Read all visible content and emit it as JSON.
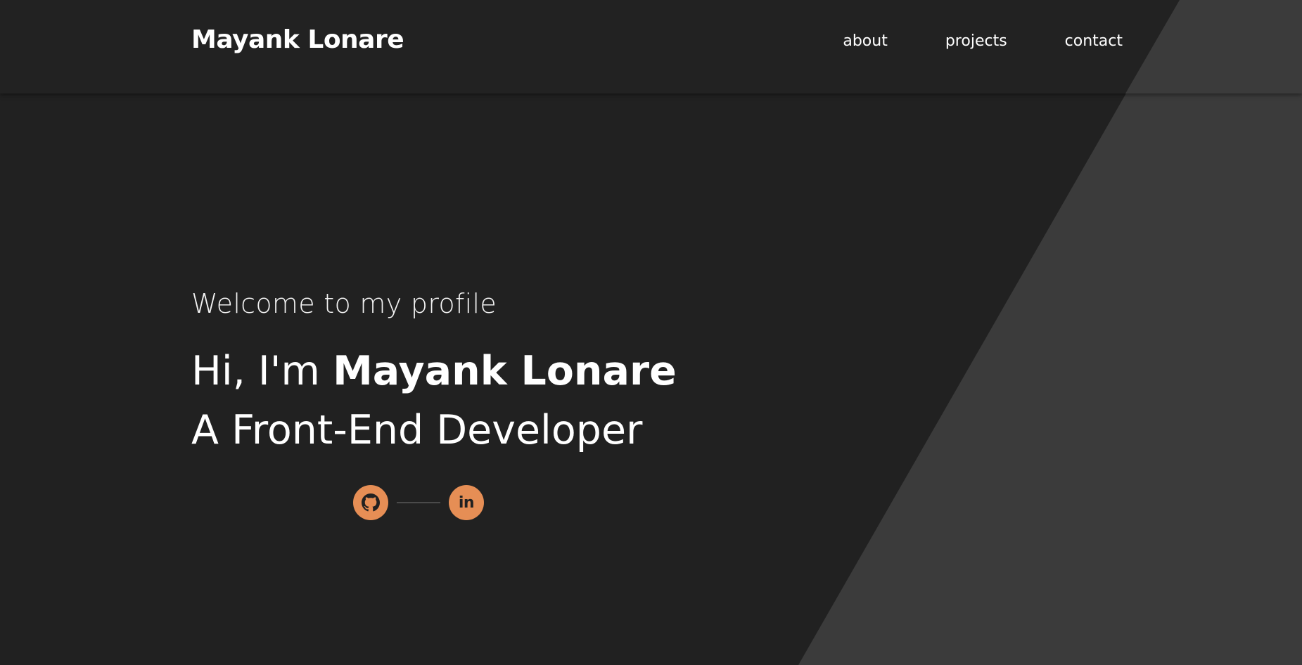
{
  "header": {
    "logo": "Mayank Lonare",
    "nav": [
      "about",
      "projects",
      "contact"
    ]
  },
  "hero": {
    "welcome": "Welcome to my profile",
    "greeting_prefix": "Hi, I'm ",
    "greeting_name": "Mayank Lonare",
    "role": "A Front-End Developer"
  },
  "socials": [
    {
      "icon": "github-icon"
    },
    {
      "icon": "linkedin-icon",
      "glyph": "in"
    }
  ],
  "colors": {
    "background": "#212121",
    "diagonal_panel": "#3b3b3b",
    "accent": "#e68e55",
    "text": "#ffffff"
  }
}
